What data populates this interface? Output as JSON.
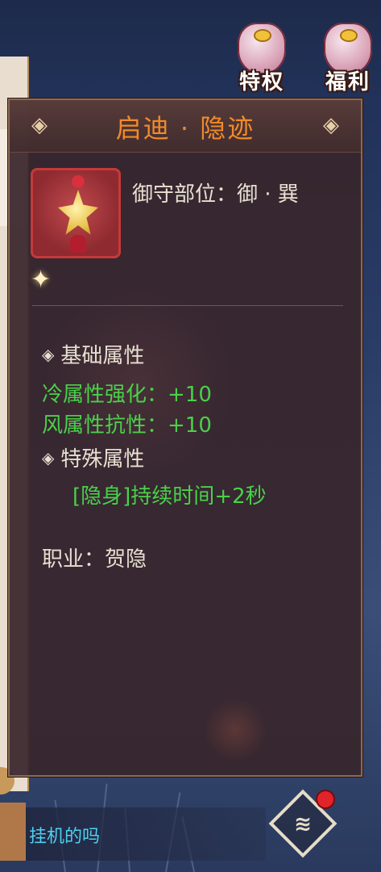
{
  "top_buttons": {
    "privilege_label": "特权",
    "welfare_label": "福利"
  },
  "tooltip": {
    "title": "启迪 · 隐迹",
    "slot_text": "御守部位：御 · 巽",
    "basic_attr_heading": "基础属性",
    "stats": [
      "冷属性强化：+10",
      "风属性抗性：+10"
    ],
    "special_attr_heading": "特殊属性",
    "special_effect": "[隐身]持续时间+2秒",
    "profession": "职业：贺隐"
  },
  "chat": {
    "message": "挂机的吗"
  },
  "colors": {
    "title": "#f08a2a",
    "stat_green": "#4ad04a",
    "item_border": "#c43a3a",
    "chat_text": "#4ed0f0"
  },
  "icons": {
    "item": "charm-icon",
    "privilege": "gift-bag-icon",
    "welfare": "gift-bag-icon",
    "menu": "menu-diamond-icon",
    "notification": "red-dot-icon"
  }
}
